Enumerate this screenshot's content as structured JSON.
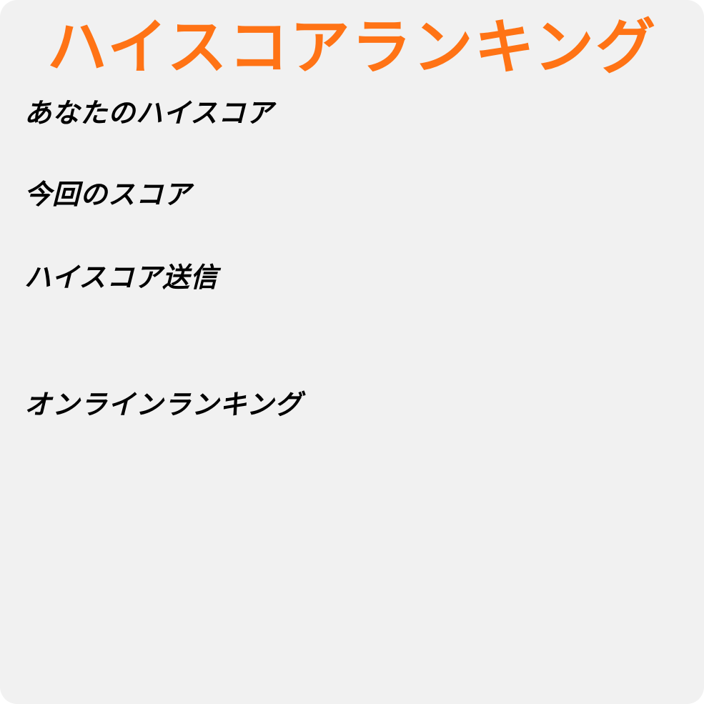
{
  "title": "ハイスコアランキング",
  "sections": {
    "high_score": {
      "label": "あなたのハイスコア",
      "value": ""
    },
    "current_score": {
      "label": "今回のスコア",
      "value": ""
    },
    "submit": {
      "label": "ハイスコア送信"
    },
    "online_ranking": {
      "label": "オンラインランキング",
      "entries": []
    }
  },
  "colors": {
    "title": "#ff7315",
    "text": "#000000",
    "panel_background": "#f1f1f1"
  }
}
